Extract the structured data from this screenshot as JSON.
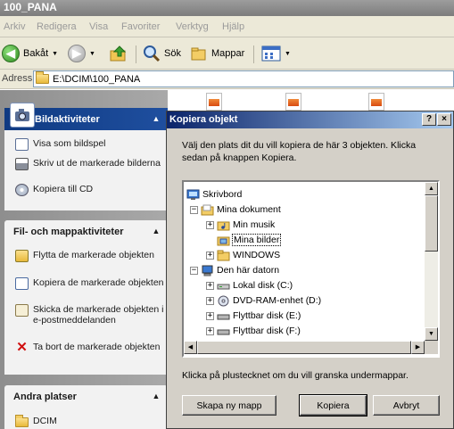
{
  "window": {
    "title": "100_PANA"
  },
  "menu": [
    "Arkiv",
    "Redigera",
    "Visa",
    "Favoriter",
    "Verktyg",
    "Hjälp"
  ],
  "toolbar": {
    "back": "Bakåt",
    "search": "Sök",
    "folders": "Mappar"
  },
  "address": {
    "label": "Adress",
    "value": "E:\\DCIM\\100_PANA"
  },
  "sidebar": {
    "image_tasks": {
      "title": "Bildaktiviteter",
      "items": [
        "Visa som bildspel",
        "Skriv ut de markerade bilderna",
        "Kopiera till CD"
      ]
    },
    "file_tasks": {
      "title": "Fil- och mappaktiviteter",
      "items": [
        "Flytta de markerade objekten",
        "Kopiera de markerade objekten",
        "Skicka de markerade objekten i e-postmeddelanden",
        "Ta bort de markerade objekten"
      ]
    },
    "other_places": {
      "title": "Andra platser",
      "items": [
        "DCIM"
      ]
    }
  },
  "dialog": {
    "title": "Kopiera objekt",
    "help": "?",
    "close": "×",
    "instruction": "Välj den plats dit du vill kopiera de här 3 objekten. Klicka sedan på knappen Kopiera.",
    "tree": [
      {
        "label": "Skrivbord",
        "level": 0,
        "expander": "",
        "icon": "desktop-icon"
      },
      {
        "label": "Mina dokument",
        "level": 1,
        "expander": "−",
        "icon": "folder-open-icon"
      },
      {
        "label": "Min musik",
        "level": 2,
        "expander": "+",
        "icon": "music-folder-icon"
      },
      {
        "label": "Mina bilder",
        "level": 2,
        "expander": "",
        "icon": "pictures-folder-icon",
        "selected": true
      },
      {
        "label": "WINDOWS",
        "level": 2,
        "expander": "+",
        "icon": "folder-icon"
      },
      {
        "label": "Den här datorn",
        "level": 1,
        "expander": "−",
        "icon": "computer-icon"
      },
      {
        "label": "Lokal disk (C:)",
        "level": 2,
        "expander": "+",
        "icon": "drive-icon"
      },
      {
        "label": "DVD-RAM-enhet (D:)",
        "level": 2,
        "expander": "+",
        "icon": "dvd-icon"
      },
      {
        "label": "Flyttbar disk (E:)",
        "level": 2,
        "expander": "+",
        "icon": "removable-drive-icon"
      },
      {
        "label": "Flyttbar disk (F:)",
        "level": 2,
        "expander": "+",
        "icon": "removable-drive-icon"
      }
    ],
    "hint": "Klicka på plustecknet om du vill granska undermappar.",
    "buttons": {
      "new_folder": "Skapa ny mapp",
      "copy": "Kopiera",
      "cancel": "Avbryt"
    }
  }
}
